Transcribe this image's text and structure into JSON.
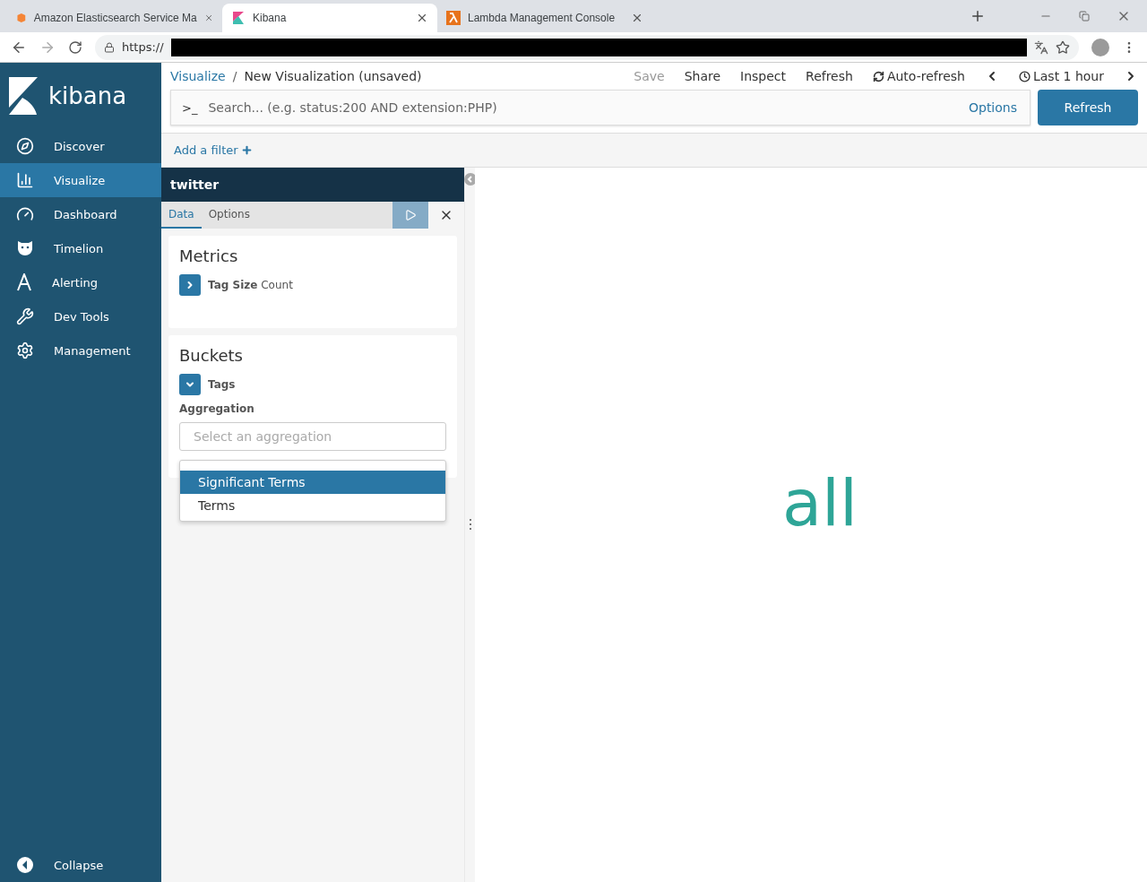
{
  "browser": {
    "tabs": [
      {
        "title": "Amazon Elasticsearch Service Ma",
        "selected": false
      },
      {
        "title": "Kibana",
        "selected": true
      },
      {
        "title": "Lambda Management Console",
        "selected": false
      }
    ],
    "url": "https://"
  },
  "sidebar": {
    "logo": "kibana",
    "items": [
      {
        "label": "Discover",
        "selected": false
      },
      {
        "label": "Visualize",
        "selected": true
      },
      {
        "label": "Dashboard",
        "selected": false
      },
      {
        "label": "Timelion",
        "selected": false
      },
      {
        "label": "Alerting",
        "selected": false
      },
      {
        "label": "Dev Tools",
        "selected": false
      },
      {
        "label": "Management",
        "selected": false
      }
    ],
    "collapse": "Collapse"
  },
  "top_nav": {
    "breadcrumbs": [
      "Visualize",
      "New Visualization (unsaved)"
    ],
    "separator": "/",
    "menu": [
      {
        "label": "Save",
        "disabled": true
      },
      {
        "label": "Share",
        "disabled": false
      },
      {
        "label": "Inspect",
        "disabled": false
      },
      {
        "label": "Refresh",
        "disabled": false
      }
    ],
    "auto_refresh": "Auto-refresh",
    "time_range": "Last 1 hour"
  },
  "query_bar": {
    "prompt": ">_",
    "placeholder": "Search... (e.g. status:200 AND extension:PHP)",
    "options": "Options",
    "button": "Refresh"
  },
  "filter_bar": {
    "add": "Add a filter"
  },
  "editor": {
    "title": "twitter",
    "tabs": [
      {
        "label": "Data",
        "selected": true
      },
      {
        "label": "Options",
        "selected": false
      }
    ],
    "metrics": {
      "title": "Metrics",
      "item": {
        "name": "Tag Size",
        "aggregation": "Count",
        "expanded": false
      }
    },
    "buckets": {
      "title": "Buckets",
      "item": {
        "name": "Tags",
        "expanded": true
      },
      "field_label": "Aggregation",
      "placeholder": "Select an aggregation",
      "options": [
        {
          "label": "Significant Terms",
          "selected": true
        },
        {
          "label": "Terms",
          "selected": false
        }
      ]
    }
  },
  "visualization": {
    "value": "all"
  }
}
